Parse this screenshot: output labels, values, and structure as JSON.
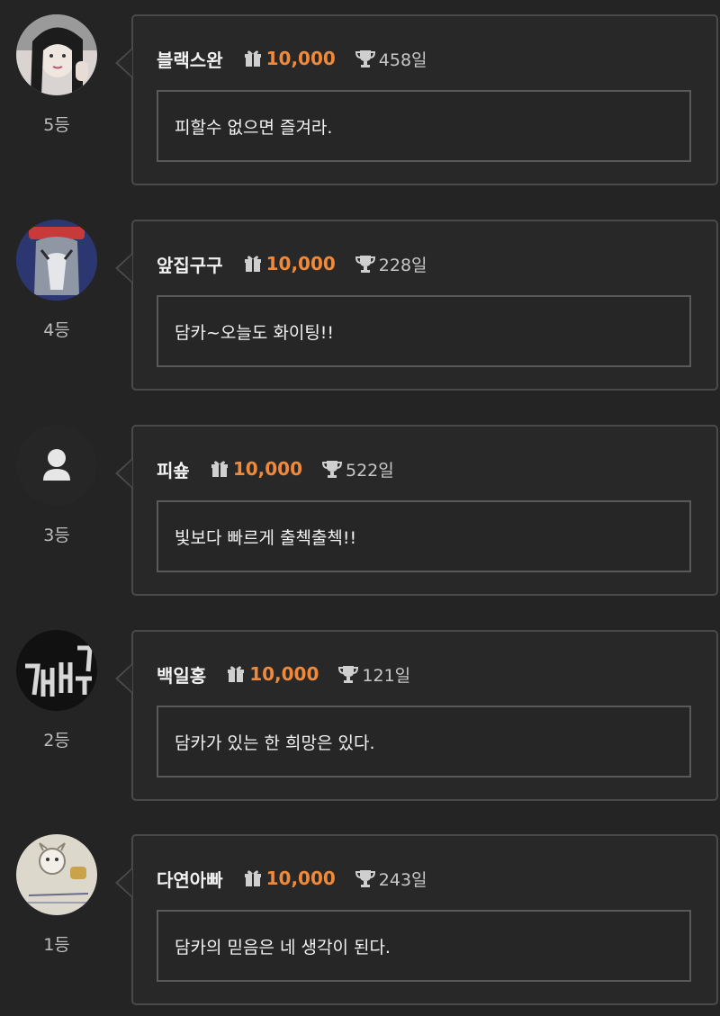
{
  "entries": [
    {
      "rank": "5등",
      "nickname": "블랙스완",
      "amount": "10,000",
      "days": "458일",
      "message": "피할수 없으면 즐겨라.",
      "avatar": "profile-photo"
    },
    {
      "rank": "4등",
      "nickname": "앞집구구",
      "amount": "10,000",
      "days": "228일",
      "message": "담카~오늘도 화이팅!!",
      "avatar": "penguin-photo"
    },
    {
      "rank": "3등",
      "nickname": "피숖",
      "amount": "10,000",
      "days": "522일",
      "message": "빛보다 빠르게 출첵출첵!!",
      "avatar": "default-user"
    },
    {
      "rank": "2등",
      "nickname": "백일홍",
      "amount": "10,000",
      "days": "121일",
      "message": "담카가 있는 한 희망은 있다.",
      "avatar": "neon-photo"
    },
    {
      "rank": "1등",
      "nickname": "다연아빠",
      "amount": "10,000",
      "days": "243일",
      "message": "담카의 믿음은 네 생각이 된다.",
      "avatar": "sketch-photo"
    }
  ],
  "icons": {
    "gift": "gift-icon",
    "trophy": "trophy-icon"
  },
  "colors": {
    "background": "#242424",
    "card_border": "#4a4a4a",
    "amount": "#f08a3a"
  }
}
